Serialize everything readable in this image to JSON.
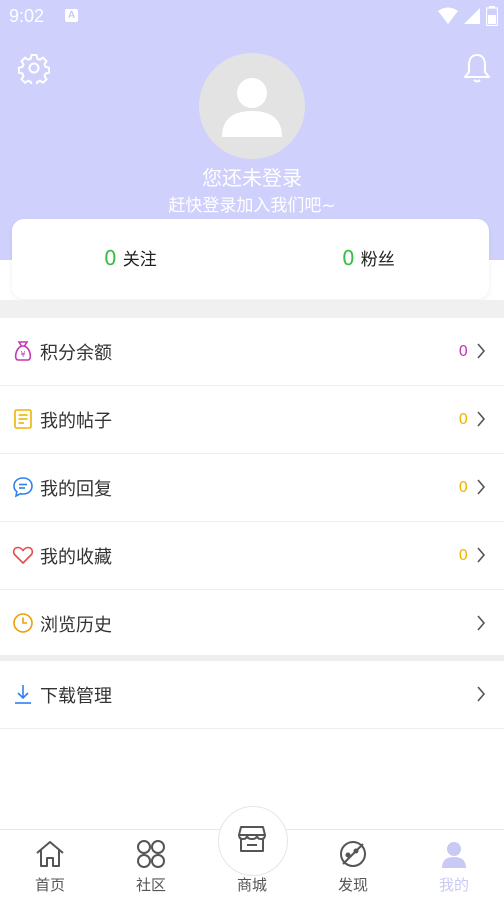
{
  "status_bar": {
    "time": "9:02",
    "badge": "A"
  },
  "colors": {
    "header": "#d0d0fc",
    "accent_green": "#3cba4a",
    "points": "#c239b3",
    "count_yellow": "#f0b400",
    "active_tab": "#c9c9f6"
  },
  "profile": {
    "title": "您还未登录",
    "subtitle": "赶快登录加入我们吧~"
  },
  "stats": {
    "following_count": "0",
    "following_label": "关注",
    "fans_count": "0",
    "fans_label": "粉丝"
  },
  "menu": [
    {
      "label": "积分余额",
      "count": "0",
      "icon": "money-bag-icon"
    },
    {
      "label": "我的帖子",
      "count": "0",
      "icon": "post-icon"
    },
    {
      "label": "我的回复",
      "count": "0",
      "icon": "comment-icon"
    },
    {
      "label": "我的收藏",
      "count": "0",
      "icon": "heart-icon"
    },
    {
      "label": "浏览历史",
      "count": "",
      "icon": "clock-icon"
    }
  ],
  "menu2": [
    {
      "label": "下载管理",
      "icon": "download-icon"
    }
  ],
  "tabs": [
    {
      "label": "首页",
      "icon": "home-icon"
    },
    {
      "label": "社区",
      "icon": "community-icon"
    },
    {
      "label": "商城",
      "icon": "shop-icon"
    },
    {
      "label": "发现",
      "icon": "discover-icon"
    },
    {
      "label": "我的",
      "icon": "profile-icon",
      "active": true
    }
  ]
}
